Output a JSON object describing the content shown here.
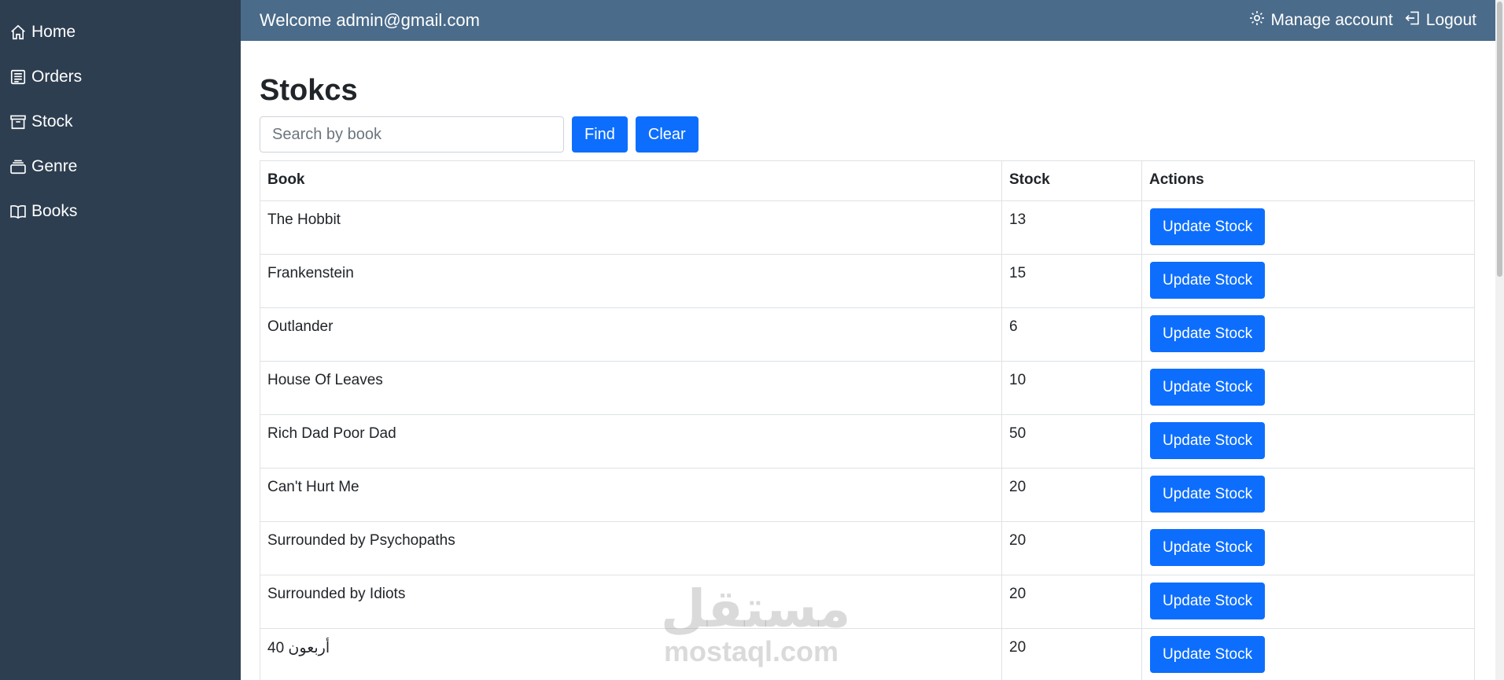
{
  "sidebar": {
    "items": [
      {
        "label": "Home",
        "icon": "home-icon"
      },
      {
        "label": "Orders",
        "icon": "orders-icon"
      },
      {
        "label": "Stock",
        "icon": "archive-icon"
      },
      {
        "label": "Genre",
        "icon": "stack-icon"
      },
      {
        "label": "Books",
        "icon": "book-icon"
      }
    ]
  },
  "header": {
    "welcome": "Welcome admin@gmail.com",
    "manage_account": "Manage account",
    "logout": "Logout"
  },
  "main": {
    "title": "Stokcs",
    "search": {
      "placeholder": "Search by book",
      "value": ""
    },
    "find_label": "Find",
    "clear_label": "Clear",
    "table": {
      "columns": [
        "Book",
        "Stock",
        "Actions"
      ],
      "rows": [
        {
          "book": "The Hobbit",
          "stock": "13",
          "action": "Update Stock"
        },
        {
          "book": "Frankenstein",
          "stock": "15",
          "action": "Update Stock"
        },
        {
          "book": "Outlander",
          "stock": "6",
          "action": "Update Stock"
        },
        {
          "book": "House Of Leaves",
          "stock": "10",
          "action": "Update Stock"
        },
        {
          "book": "Rich Dad Poor Dad",
          "stock": "50",
          "action": "Update Stock"
        },
        {
          "book": "Can't Hurt Me",
          "stock": "20",
          "action": "Update Stock"
        },
        {
          "book": "Surrounded by Psychopaths",
          "stock": "20",
          "action": "Update Stock"
        },
        {
          "book": "Surrounded by Idiots",
          "stock": "20",
          "action": "Update Stock"
        },
        {
          "book": "أربعون 40",
          "stock": "20",
          "action": "Update Stock"
        }
      ]
    }
  },
  "watermark": {
    "arabic": "مستقل",
    "latin": "mostaql.com"
  },
  "colors": {
    "sidebar_bg": "#2d3e50",
    "topbar_bg": "#4a6b8a",
    "primary": "#0d6efd"
  }
}
